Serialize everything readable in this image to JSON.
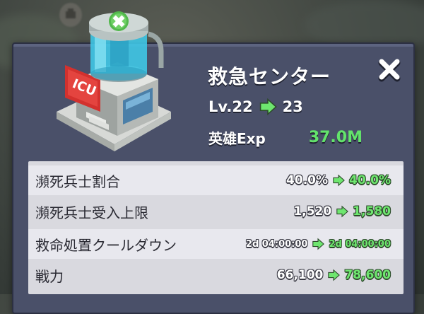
{
  "header": {
    "title": "救急センター",
    "level_prefix": "Lv.22",
    "level_next": "23",
    "exp_label": "英雄Exp",
    "exp_value": "37.0M"
  },
  "stats": [
    {
      "label": "瀕死兵士割合",
      "old": "40.0%",
      "new": "40.0%"
    },
    {
      "label": "瀕死兵士受入上限",
      "old": "1,520",
      "new": "1,580"
    },
    {
      "label": "救命処置クールダウン",
      "old": "2d 04:00:00",
      "new": "2d 04:00:00"
    },
    {
      "label": "戦力",
      "old": "66,100",
      "new": "78,600"
    }
  ],
  "colors": {
    "panel": "#4a5069",
    "accent_green": "#63e36b",
    "stats_bg": "#d9d9df"
  },
  "icons": [
    "close-icon",
    "arrow-right-icon",
    "icu-building-icon",
    "map-pin-icon"
  ]
}
